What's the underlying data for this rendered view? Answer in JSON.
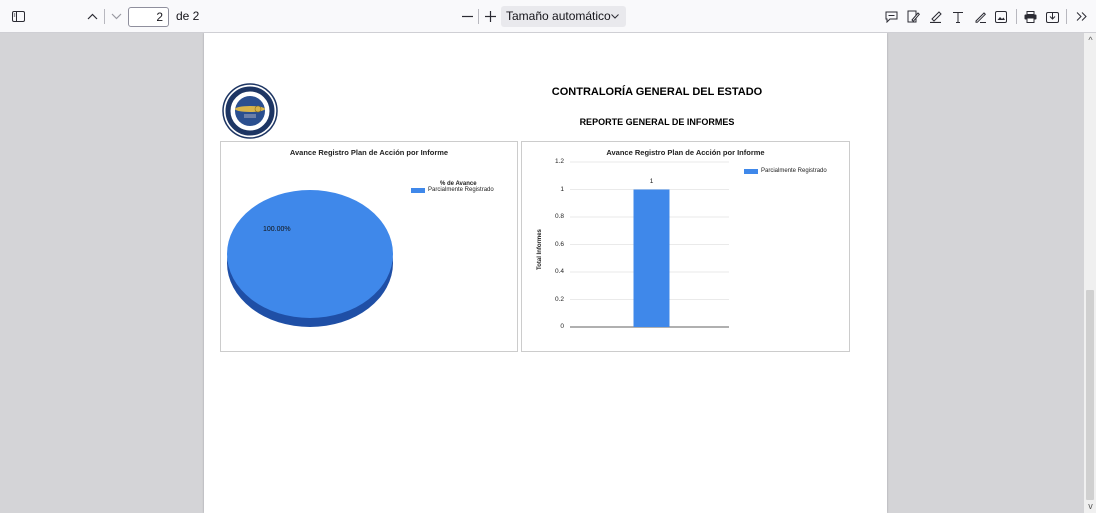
{
  "toolbar": {
    "page_number": "2",
    "page_count_label": "de 2",
    "zoom_label": "Tamaño automático",
    "icons": [
      "sidebar-toggle-icon",
      "previous-page-icon",
      "next-page-icon",
      "zoom-out-icon",
      "zoom-in-icon",
      "comment-icon",
      "signature-icon",
      "highlight-icon",
      "text-icon",
      "draw-icon",
      "image-icon",
      "print-icon",
      "save-icon",
      "more-tools-icon"
    ]
  },
  "document": {
    "title": "CONTRALORÍA GENERAL DEL ESTADO",
    "subtitle": "REPORTE GENERAL DE INFORMES"
  },
  "colors": {
    "series": "#3f88ea",
    "series_dark": "#1f4fa6"
  },
  "chart_data": [
    {
      "type": "pie",
      "title": "Avance Registro Plan de Acción por Informe",
      "legend_title": "% de Avance",
      "legend_position": "top-right",
      "slices": [
        {
          "label": "Parcialmente Registrado",
          "value": 100,
          "display": "100.00%"
        }
      ]
    },
    {
      "type": "bar",
      "title": "Avance Registro Plan de Acción por Informe",
      "xlabel": "",
      "ylabel": "Total Informes",
      "ylim": [
        0,
        1.2
      ],
      "yticks": [
        "0",
        "0.2",
        "0.4",
        "0.6",
        "0.8",
        "1",
        "1.2"
      ],
      "legend_position": "top-right",
      "series": [
        {
          "name": "Parcialmente Registrado",
          "values": [
            1
          ],
          "labels": [
            "1"
          ]
        }
      ],
      "grid": true
    }
  ]
}
